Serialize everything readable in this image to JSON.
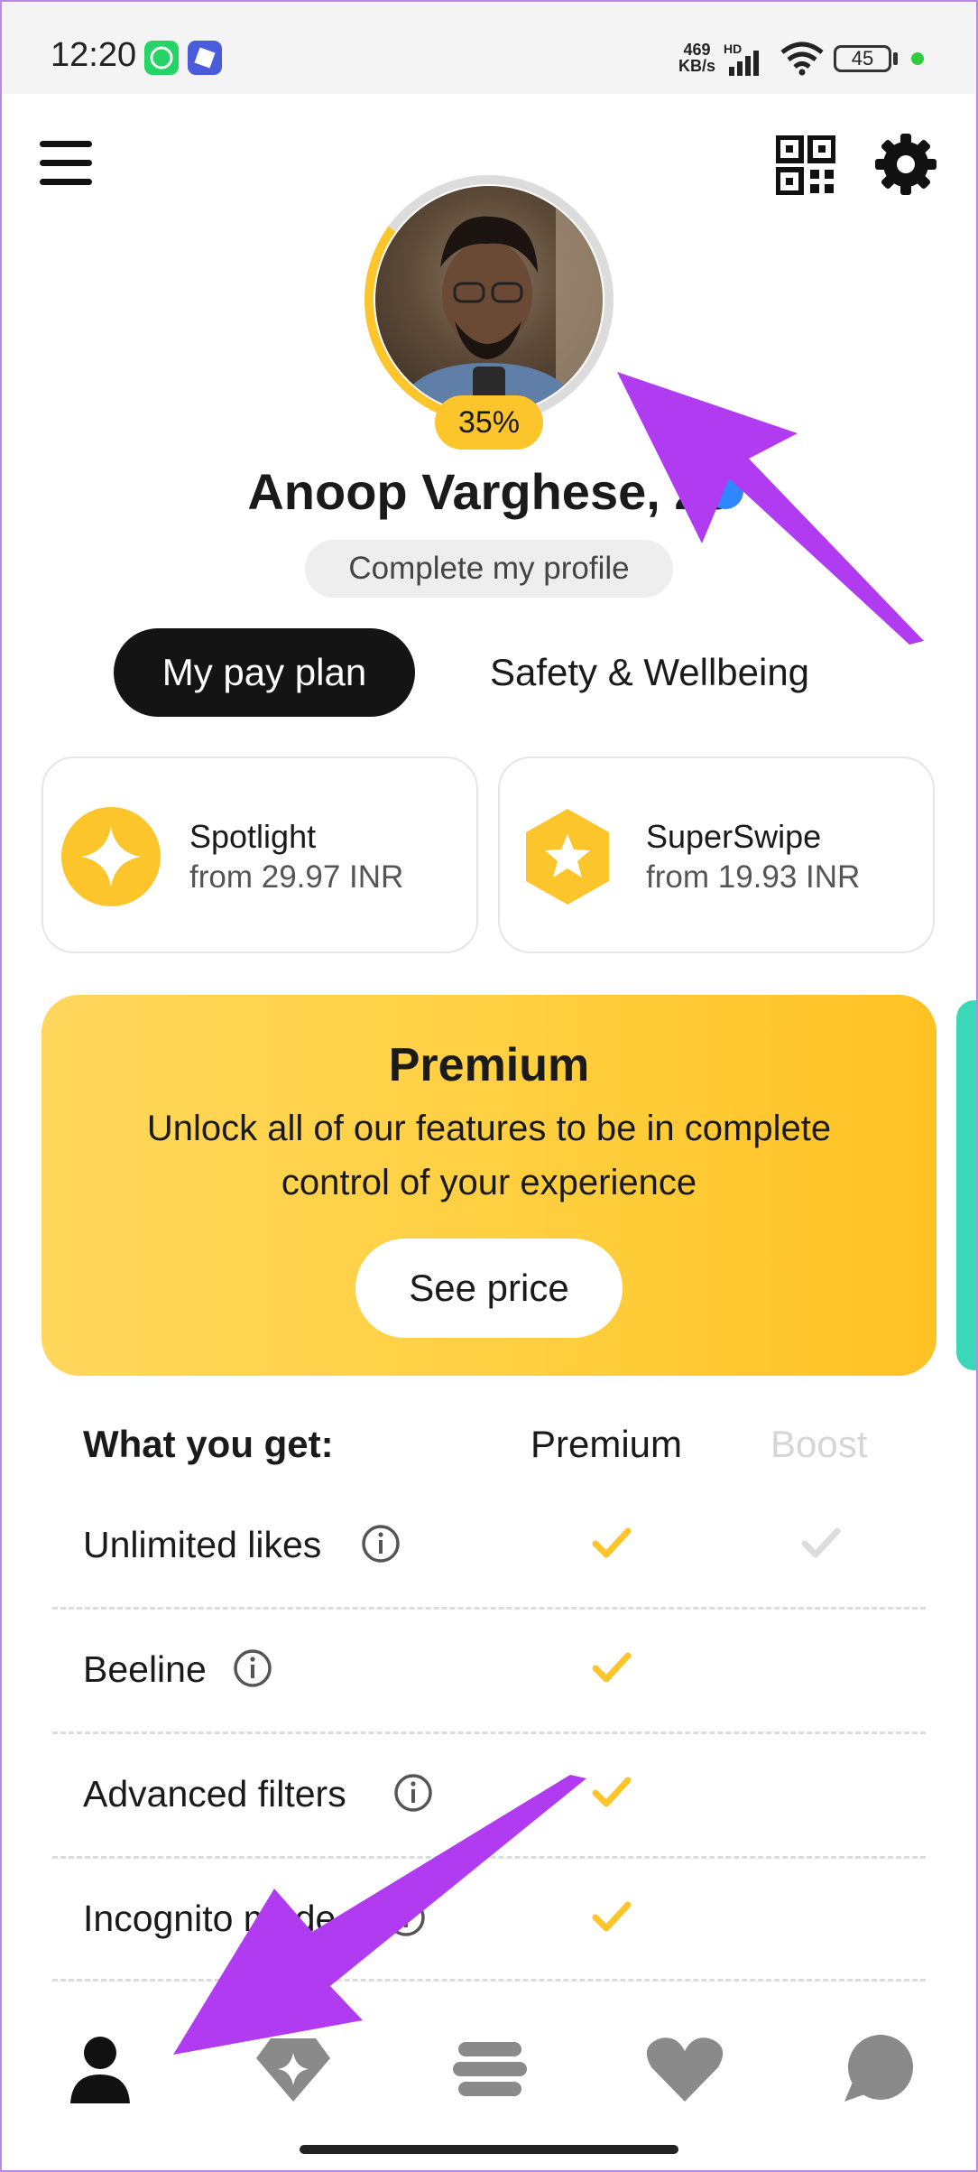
{
  "status_bar": {
    "time": "12:20",
    "net_speed_value": "469",
    "net_speed_unit": "KB/s",
    "hd_label": "HD",
    "battery_level": "45",
    "app_icons": [
      "whatsapp-icon",
      "app-icon"
    ]
  },
  "profile": {
    "name": "Anoop Varghese, 23",
    "completion_percent": "35%",
    "completion_fraction": 0.35,
    "complete_button": "Complete my profile"
  },
  "tabs": [
    {
      "label": "My pay plan",
      "active": true
    },
    {
      "label": "Safety & Wellbeing",
      "active": false
    }
  ],
  "features": [
    {
      "title": "Spotlight",
      "subtitle": "from 29.97 INR",
      "icon": "spotlight-icon"
    },
    {
      "title": "SuperSwipe",
      "subtitle": "from 19.93 INR",
      "icon": "superswipe-icon"
    }
  ],
  "premium": {
    "title": "Premium",
    "description": "Unlock all of our features to be in complete control of your experience",
    "button": "See price"
  },
  "comparison": {
    "header_label": "What you get:",
    "col_premium": "Premium",
    "col_boost": "Boost",
    "rows": [
      {
        "label": "Unlimited likes",
        "premium": true,
        "boost": true
      },
      {
        "label": "Beeline",
        "premium": true,
        "boost": false
      },
      {
        "label": "Advanced filters",
        "premium": true,
        "boost": false
      },
      {
        "label": "Incognito mode",
        "premium": true,
        "boost": false
      }
    ]
  },
  "bottom_nav": [
    "profile-icon",
    "discover-icon",
    "people-icon",
    "likes-icon",
    "chats-icon"
  ],
  "colors": {
    "accent_yellow": "#fcc52b",
    "dark": "#141414",
    "annotation_purple": "#b13bf0",
    "teal": "#3cd6b8",
    "verified_blue": "#2f86ff"
  }
}
